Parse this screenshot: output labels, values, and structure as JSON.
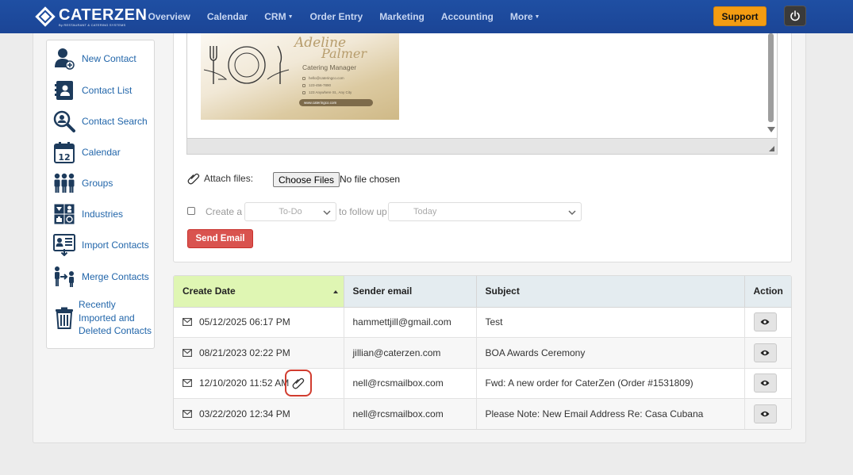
{
  "app": {
    "brand": "CATERZEN",
    "brand_sub": "By RESTAURANT & CATERING SYSTEMS"
  },
  "nav": {
    "items": [
      {
        "label": "Overview"
      },
      {
        "label": "Calendar"
      },
      {
        "label": "CRM",
        "dropdown": true
      },
      {
        "label": "Order Entry"
      },
      {
        "label": "Marketing"
      },
      {
        "label": "Accounting"
      },
      {
        "label": "More",
        "dropdown": true
      }
    ],
    "support_label": "Support",
    "power_icon": "power-icon"
  },
  "sidebar": {
    "items": [
      {
        "label": "New Contact",
        "icon": "add-user-icon"
      },
      {
        "label": "Contact List",
        "icon": "contact-book-icon"
      },
      {
        "label": "Contact Search",
        "icon": "search-user-icon"
      },
      {
        "label": "Calendar",
        "icon": "calendar-icon",
        "day": "12"
      },
      {
        "label": "Groups",
        "icon": "group-icon"
      },
      {
        "label": "Industries",
        "icon": "industries-icon"
      },
      {
        "label": "Import Contacts",
        "icon": "import-icon"
      },
      {
        "label": "Merge Contacts",
        "icon": "merge-icon"
      },
      {
        "label": "Recently Imported and Deleted Contacts",
        "icon": "trash-icon"
      }
    ]
  },
  "business_card": {
    "first_name": "Adeline",
    "last_name": "Palmer",
    "title": "Catering Manager",
    "email": "hello@cateringco.com",
    "phone": "123-456-7890",
    "address": "123 Anywhere St., Any City",
    "website": "www.cateringco.com"
  },
  "composer": {
    "attach_label": "Attach files:",
    "choose_files_label": "Choose Files",
    "file_status": "No file chosen",
    "create_a_label": "Create a",
    "todo_select": "To-Do",
    "follow_up_label": "to follow up",
    "today_select": "Today",
    "send_label": "Send Email"
  },
  "table": {
    "columns": [
      "Create Date",
      "Sender email",
      "Subject",
      "Action"
    ],
    "rows": [
      {
        "date": "05/12/2025 06:17 PM",
        "sender": "hammettjill@gmail.com",
        "subject": "Test",
        "attachment": false
      },
      {
        "date": "08/21/2023 02:22 PM",
        "sender": "jillian@caterzen.com",
        "subject": "BOA Awards Ceremony",
        "attachment": false
      },
      {
        "date": "12/10/2020 11:52 AM",
        "sender": "nell@rcsmailbox.com",
        "subject": "Fwd: A new order for CaterZen (Order #1531809)",
        "attachment": true
      },
      {
        "date": "03/22/2020 12:34 PM",
        "sender": "nell@rcsmailbox.com",
        "subject": "Please Note: New Email Address Re: Casa Cubana",
        "attachment": false
      }
    ]
  },
  "colors": {
    "nav_bg": "#1f4fa3",
    "support": "#f39c12",
    "send": "#d9534f",
    "sorted_header": "#dff6b3",
    "highlight": "#d13c2f",
    "link": "#2266aa"
  }
}
